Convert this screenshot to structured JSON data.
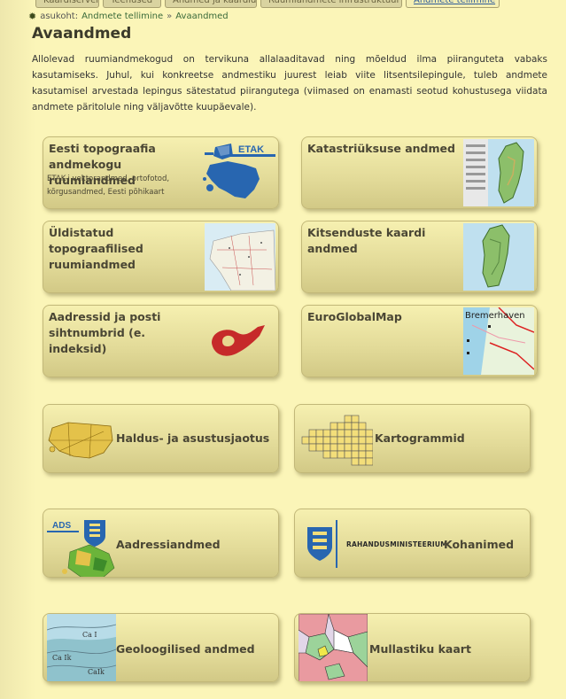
{
  "tabs": [
    "Kaardiserver",
    "Teenused",
    "Andmed ja kaardid",
    "Ruumiandmete infrastruktuur",
    "Andmete tellimine"
  ],
  "breadcrumb": {
    "prefix": "asukoht:",
    "items": [
      "Andmete tellimine",
      "Avaandmed"
    ],
    "separator": "»"
  },
  "page_title": "Avaandmed",
  "intro": "Allolevad ruumiandmekogud on tervikuna allalaaditavad ning mõeldud ilma piiranguteta vabaks kasutamiseks. Juhul, kui konkreetse andmestiku juurest leiab viite litsentsilepingule, tuleb andmete kasutamisel arvestada lepingus sätestatud piirangutega (viimased on enamasti seotud kohustusega viidata andmete päritolule ning väljavõtte kuupäevale).",
  "cards": {
    "etak": {
      "title": "Eesti topograafia andmekogu ruumiandmed",
      "subtitle": "ETAK-i vektorandmed, ortofotod, kõrgusandmed, Eesti põhikaart",
      "logo_text": "ETAK"
    },
    "katastri": {
      "title": "Katastriüksuse andmed"
    },
    "yldistatud": {
      "title": "Üldistatud topograafilised ruumiandmed"
    },
    "kitsenduste": {
      "title": "Kitsenduste kaardi andmed"
    },
    "aadressid": {
      "title": "Aadressid ja posti sihtnumbrid (e. indeksid)"
    },
    "euroglobalmap": {
      "title": "EuroGlobalMap",
      "map_label": "Bremerhaven"
    },
    "haldus": {
      "title": "Haldus- ja asustusjaotus"
    },
    "kartogrammid": {
      "title": "Kartogrammid"
    },
    "aadressiandmed": {
      "title": "Aadressiandmed",
      "logo_text": "ADS"
    },
    "kohanimed": {
      "title": "Kohanimed",
      "ministry": "RAHANDUSMINISTEERIUM"
    },
    "geoloogilised": {
      "title": "Geoloogilised andmed",
      "map_labels": [
        "Ca I",
        "Ca Ik",
        "CaIk"
      ]
    },
    "mullastiku": {
      "title": "Mullastiku kaart"
    }
  },
  "colors": {
    "background": "#fbf5b8",
    "card_top": "#f6f0b0",
    "card_bottom": "#d2c986",
    "brand_blue": "#2866b0",
    "post_red": "#c62a2a"
  }
}
